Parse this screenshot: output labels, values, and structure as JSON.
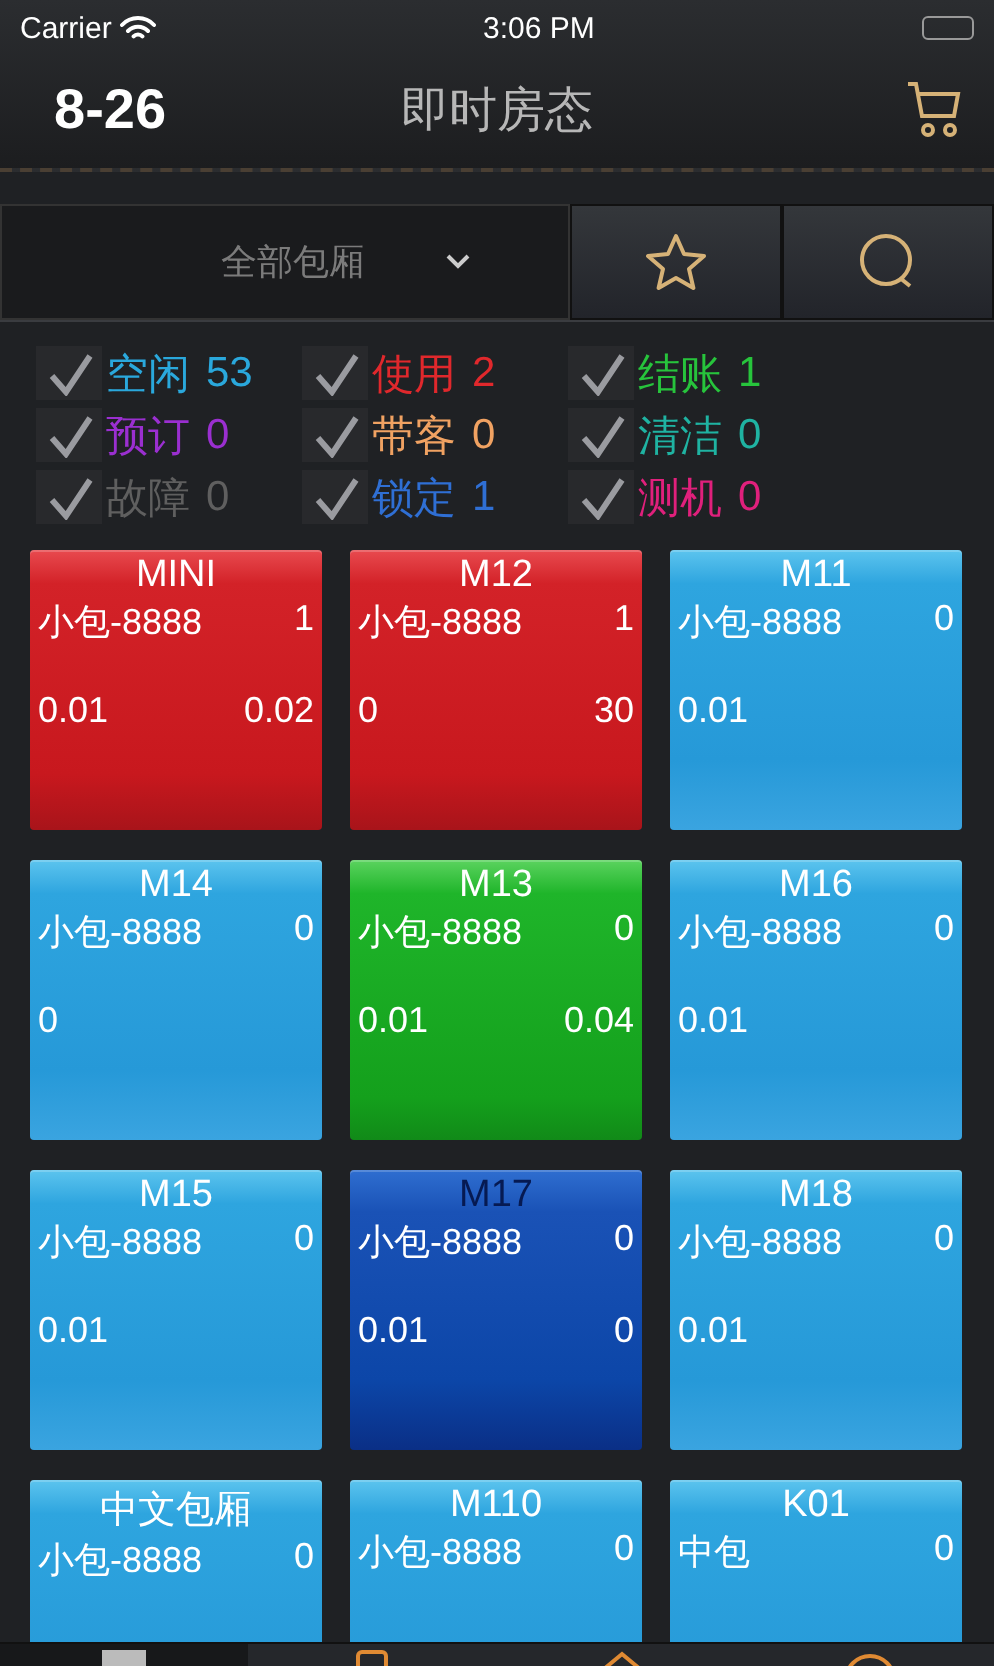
{
  "status_bar": {
    "carrier": "Carrier",
    "time": "3:06 PM"
  },
  "nav_bar": {
    "date": "8-26",
    "title": "即时房态"
  },
  "toolbar": {
    "dropdown": "全部包厢"
  },
  "legend": [
    {
      "label": "空闲",
      "count": "53",
      "color": "#2aa8dc",
      "checked": true
    },
    {
      "label": "使用",
      "count": "2",
      "color": "#e0282c",
      "checked": true
    },
    {
      "label": "结账",
      "count": "1",
      "color": "#27c43c",
      "checked": true
    },
    {
      "label": "预订",
      "count": "0",
      "color": "#9a2fd0",
      "checked": true
    },
    {
      "label": "带客",
      "count": "0",
      "color": "#f0a262",
      "checked": true
    },
    {
      "label": "清洁",
      "count": "0",
      "color": "#1fb3a2",
      "checked": true
    },
    {
      "label": "故障",
      "count": "0",
      "color": "#5f5f5f",
      "checked": true
    },
    {
      "label": "锁定",
      "count": "1",
      "color": "#2f6fd4",
      "checked": true
    },
    {
      "label": "测机",
      "count": "0",
      "color": "#e0207c",
      "checked": true
    }
  ],
  "rooms": [
    {
      "name": "MINI",
      "kind": "busy",
      "type": "小包-8888",
      "guests": "1",
      "value_1": "0.01",
      "value_2": "0.02"
    },
    {
      "name": "M12",
      "kind": "busy",
      "type": "小包-8888",
      "guests": "1",
      "value_1": "0",
      "value_2": "30"
    },
    {
      "name": "M11",
      "kind": "free",
      "type": "小包-8888",
      "guests": "0",
      "value_1": "0.01"
    },
    {
      "name": "M14",
      "kind": "free",
      "type": "小包-8888",
      "guests": "0",
      "value_1": "0"
    },
    {
      "name": "M13",
      "kind": "billing",
      "type": "小包-8888",
      "guests": "0",
      "value_1": "0.01",
      "value_2": "0.04"
    },
    {
      "name": "M16",
      "kind": "free",
      "type": "小包-8888",
      "guests": "0",
      "value_1": "0.01"
    },
    {
      "name": "M15",
      "kind": "free",
      "type": "小包-8888",
      "guests": "0",
      "value_1": "0.01"
    },
    {
      "name": "M17",
      "kind": "locked",
      "type": "小包-8888",
      "guests": "0",
      "value_1": "0.01",
      "value_2": "0"
    },
    {
      "name": "M18",
      "kind": "free",
      "type": "小包-8888",
      "guests": "0",
      "value_1": "0.01"
    },
    {
      "name": "中文包厢",
      "kind": "free",
      "type": "小包-8888",
      "guests": "0"
    },
    {
      "name": "M110",
      "kind": "free",
      "type": "小包-8888",
      "guests": "0"
    },
    {
      "name": "K01",
      "kind": "free",
      "type": "中包",
      "guests": "0"
    }
  ],
  "tab_bar": [
    {
      "selected": true
    },
    {
      "selected": false
    },
    {
      "selected": false
    },
    {
      "selected": false
    }
  ]
}
